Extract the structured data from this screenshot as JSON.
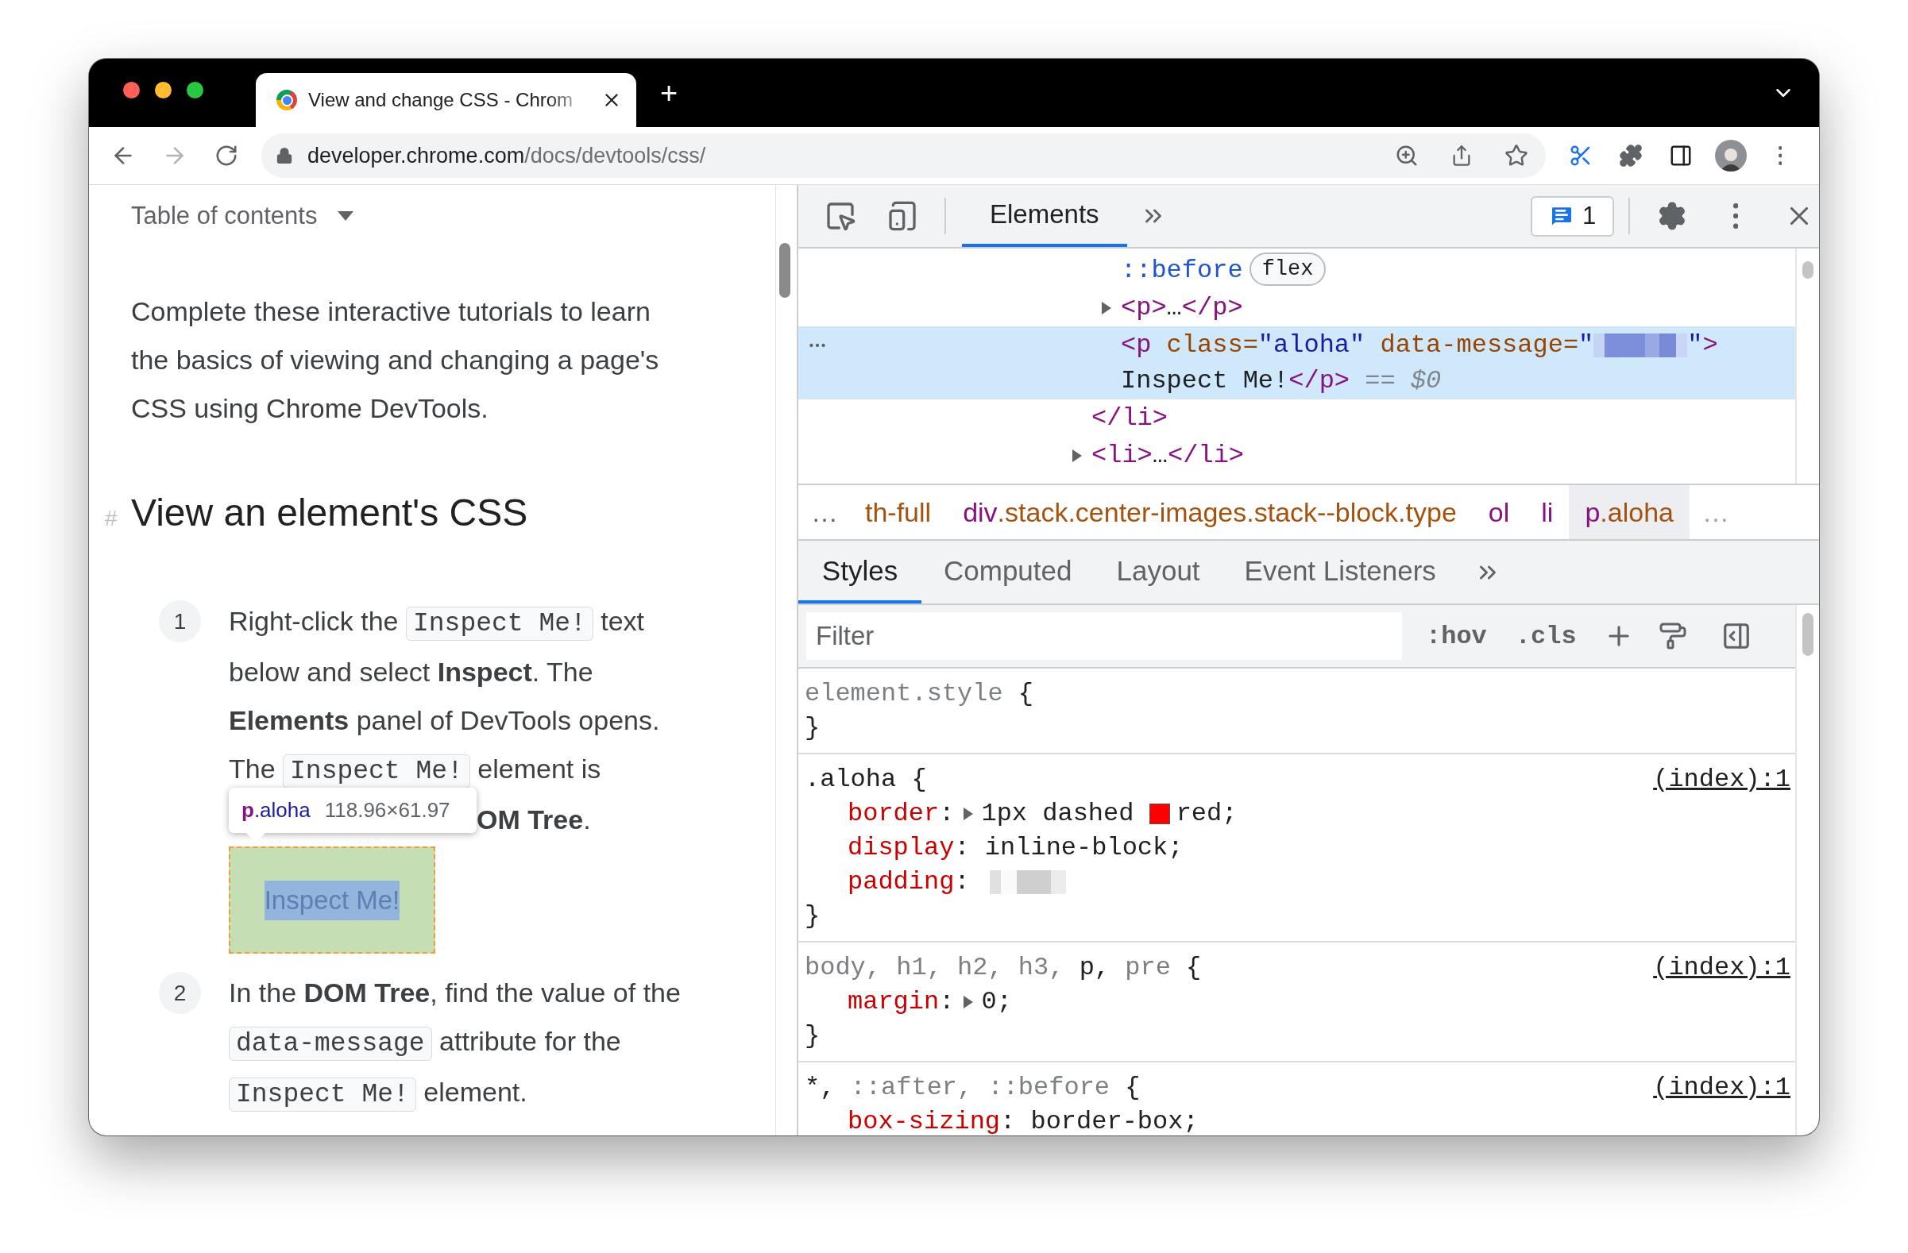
{
  "browser": {
    "tab": {
      "title": "View and change CSS - Chrom",
      "selected": true
    },
    "new_tab": "+",
    "url": {
      "host": "developer.chrome.com",
      "path": "/docs/devtools/css/"
    }
  },
  "page": {
    "toc": "Table of contents",
    "intro": [
      "Complete these interactive tutorials to learn",
      "the basics of viewing and changing a page's",
      "CSS using Chrome DevTools."
    ],
    "heading_mark": "#",
    "heading": "View an element's CSS",
    "steps": [
      {
        "number": "1",
        "lines": [
          [
            {
              "kind": "text",
              "text": "Right-click the "
            },
            {
              "kind": "code",
              "text": "Inspect Me!"
            },
            {
              "kind": "text",
              "text": " text"
            }
          ],
          [
            {
              "kind": "text",
              "text": "below and select **Inspect**. The"
            }
          ],
          [
            {
              "kind": "text",
              "text": "**Elements** panel of DevTools opens."
            }
          ],
          [
            {
              "kind": "text",
              "text": "The "
            },
            {
              "kind": "code",
              "text": "Inspect Me!"
            },
            {
              "kind": "text",
              "text": " element is"
            }
          ]
        ],
        "covered_tail": "**OM Tree**.",
        "tooltip": {
          "tag": "p",
          "classes": ".aloha",
          "size": "118.96×61.97"
        },
        "demo": "Inspect Me!"
      },
      {
        "number": "2",
        "lines": [
          [
            {
              "kind": "text",
              "text": "In the **DOM Tree**, find the value of the"
            }
          ],
          [
            {
              "kind": "code",
              "text": "data-message"
            },
            {
              "kind": "text",
              "text": " attribute for the"
            }
          ],
          [
            {
              "kind": "code",
              "text": "Inspect Me!"
            },
            {
              "kind": "text",
              "text": " element."
            }
          ]
        ]
      }
    ]
  },
  "devtools": {
    "tabs": [
      {
        "label": "Elements",
        "selected": true
      }
    ],
    "issues": "1",
    "dom_tree": [
      {
        "kind": "element",
        "closing": [
          {
            "kind": "tag",
            "text": "</li>"
          }
        ],
        "children": [
          {
            "kind": "pseudo",
            "selected": false,
            "label": "::before",
            "badge": "flex"
          },
          {
            "kind": "element",
            "selected": false,
            "expanded": false,
            "lines": [
              [
                {
                  "kind": "tag",
                  "text": "<p>"
                },
                {
                  "kind": "text",
                  "text": "…"
                },
                {
                  "kind": "tag",
                  "text": "</p>"
                }
              ]
            ]
          },
          {
            "kind": "element",
            "selected": true,
            "lines": [
              [
                {
                  "kind": "tag",
                  "text": "<p"
                },
                {
                  "kind": "attr",
                  "text": " class="
                },
                {
                  "kind": "value",
                  "text": "\"aloha\""
                },
                {
                  "kind": "attr",
                  "text": " data-message="
                },
                {
                  "kind": "value",
                  "text": "\""
                },
                {
                  "kind": "redacted"
                },
                {
                  "kind": "value",
                  "text": "\""
                },
                {
                  "kind": "tag",
                  "text": ">"
                }
              ],
              [
                {
                  "kind": "text",
                  "text": "Inspect Me!"
                },
                {
                  "kind": "tag",
                  "text": "</p>"
                },
                {
                  "kind": "hint",
                  "text": " == "
                },
                {
                  "kind": "hint-var",
                  "text": "$0"
                }
              ]
            ]
          }
        ]
      },
      {
        "kind": "element",
        "selected": false,
        "expanded": false,
        "lines": [
          [
            {
              "kind": "tag",
              "text": "<li>"
            },
            {
              "kind": "text",
              "text": "…"
            },
            {
              "kind": "tag",
              "text": "</li>"
            }
          ]
        ]
      }
    ],
    "breadcrumb_start": "…",
    "breadcrumbs": [
      {
        "classes": "th-full",
        "selected": false
      },
      {
        "tag": "div",
        "classes": ".stack.center-images.stack--block.type",
        "selected": false
      },
      {
        "tag": "ol",
        "selected": false
      },
      {
        "tag": "li",
        "selected": false
      },
      {
        "tag": "p",
        "classes": ".aloha",
        "selected": true
      }
    ],
    "breadcrumb_end": "…",
    "sub_tabs": [
      {
        "label": "Styles",
        "selected": true
      },
      {
        "label": "Computed",
        "selected": false
      },
      {
        "label": "Layout",
        "selected": false
      },
      {
        "label": "Event Listeners",
        "selected": false
      }
    ],
    "filter": {
      "placeholder": "Filter"
    },
    "hov": ":hov",
    "cls": ".cls",
    "rules": [
      {
        "selectors": [
          {
            "text": "element.style",
            "dimmed": true
          }
        ],
        "open": " {",
        "close": "}"
      },
      {
        "selectors": [
          {
            "text": ".aloha",
            "dimmed": false
          }
        ],
        "open": " {",
        "close": "}",
        "source": "(index):1",
        "declarations": [
          {
            "property": "border",
            "colon": ":",
            "expandable": true,
            "value": "1px dashed ",
            "color": "#ff0000",
            "value_tail": "red;"
          },
          {
            "property": "display",
            "colon": ":",
            "expandable": false,
            "value": "inline-block;"
          },
          {
            "property": "padding",
            "colon": ":",
            "expandable": false,
            "redacted": true
          }
        ]
      },
      {
        "selectors": [
          {
            "text": "body, ",
            "dimmed": true
          },
          {
            "text": "h1, ",
            "dimmed": true
          },
          {
            "text": "h2, ",
            "dimmed": true
          },
          {
            "text": "h3, ",
            "dimmed": true
          },
          {
            "text": "p, ",
            "dimmed": false
          },
          {
            "text": "pre",
            "dimmed": true
          }
        ],
        "open": " {",
        "close": "}",
        "source": "(index):1",
        "declarations": [
          {
            "property": "margin",
            "colon": ":",
            "expandable": true,
            "value": "0;"
          }
        ]
      },
      {
        "selectors": [
          {
            "text": "*, ",
            "dimmed": false
          },
          {
            "text": "::after, ",
            "dimmed": true
          },
          {
            "text": "::before",
            "dimmed": true
          }
        ],
        "open": " {",
        "source": "(index):1",
        "declarations": [
          {
            "property": "box-sizing",
            "colon": ":",
            "expandable": false,
            "value": "border-box;"
          }
        ]
      }
    ]
  }
}
